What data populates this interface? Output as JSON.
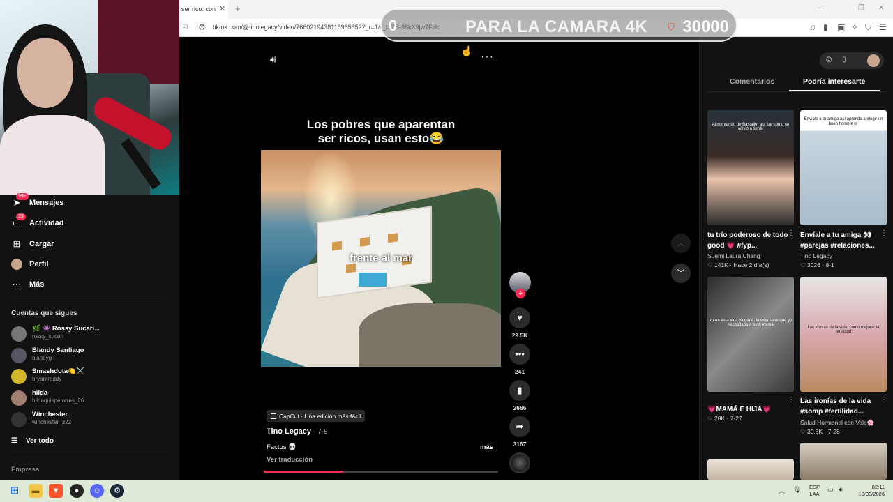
{
  "browser": {
    "tab_title": "ser rico: con",
    "url": "tiktok.com/@tinolegacy/video/7660219438116965652?_r=1&_t=ZS-98kX9jw7FHc"
  },
  "overlay": {
    "left_text": "0",
    "center_text": "PARA LA CAMARA 4K",
    "right_number": "30000"
  },
  "sidebar": {
    "nav": [
      {
        "label": "Mensajes",
        "icon": "send-icon",
        "badge": "99+"
      },
      {
        "label": "Actividad",
        "icon": "inbox-icon",
        "badge": "23"
      },
      {
        "label": "Cargar",
        "icon": "plus-square-icon",
        "badge": ""
      },
      {
        "label": "Perfil",
        "icon": "avatar-icon",
        "badge": ""
      },
      {
        "label": "Más",
        "icon": "more-icon",
        "badge": ""
      }
    ],
    "following_title": "Cuentas que sigues",
    "following": [
      {
        "name": "🌿 👾 Rossy Sucari...",
        "user": "rossy_sucari"
      },
      {
        "name": "Blandy Santiago",
        "user": "blandyg"
      },
      {
        "name": "Smashdota🍋⚔️",
        "user": "bryanfreddy"
      },
      {
        "name": "hilda",
        "user": "hildaquispetorres_26"
      },
      {
        "name": "Winchester",
        "user": "winchester_322"
      }
    ],
    "see_all": "Ver todo",
    "footer": "Empresa"
  },
  "video": {
    "caption_line1": "Los pobres que aparentan",
    "caption_line2": "ser ricos, usan esto😂",
    "frame_text": "frente al mar",
    "capcut": "CapCut · Una edición más fácil",
    "author": "Tino Legacy",
    "date": "· 7-8",
    "description": "Factos 💀",
    "more": "más",
    "translate": "Ver traducción",
    "progress": 0.34,
    "likes": "29.5K",
    "comments": "241",
    "saves": "2686",
    "shares": "3167"
  },
  "right_panel": {
    "tab_comments": "Comentarios",
    "tab_interest": "Podría interesarte",
    "cards": [
      {
        "thumb_text": "Alimentando de Bastaijo, así fue cómo se volvió a sentir",
        "title": "tu trío poderoso de todo good 💗 #fyp...",
        "author": "Suemi Laura Chang",
        "stats": "♡ 141K · Hace 2 día(s)"
      },
      {
        "thumb_text": "Envíale a tu amiga así aprenda a elegir un buen hombre💀",
        "title": "Envíale a tu amiga 👀 #parejas #relaciones...",
        "author": "Tino Legacy",
        "stats": "♡ 3026 · 8-1"
      },
      {
        "thumb_text": "Yo en esta vida ya gané, la vida sabe que yo necesitaba a esta mamá",
        "title": "💗MAMÁ E HIJA💗",
        "author": "",
        "stats": "♡ 28K · 7-27"
      },
      {
        "thumb_text": "Las ironías de la vida: cómo mejorar la fertilidad",
        "title": "Las ironías de la vida #somp #fertilidad...",
        "author": "Salud Hormonal con Vale🌸",
        "stats": "♡ 30.8K · 7-28"
      }
    ]
  },
  "taskbar": {
    "lang1": "ESP",
    "lang2": "LAA",
    "time": "02:11",
    "date": "10/08/2026"
  }
}
